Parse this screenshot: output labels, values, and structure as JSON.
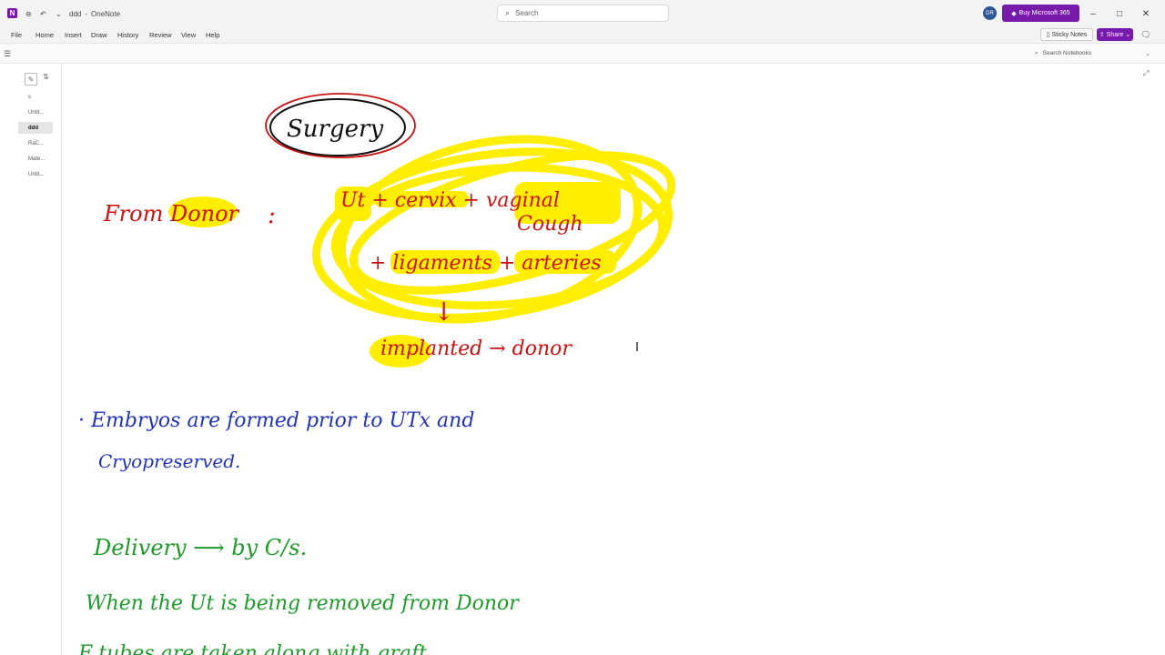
{
  "window": {
    "app_icon_letter": "N",
    "title": "ddd",
    "separator": "-",
    "app_name": "OneNote",
    "search_placeholder": "Search",
    "avatar_initials": "DR",
    "buy_label": "Buy Microsoft 365",
    "controls": {
      "min": "–",
      "max": "□",
      "close": "✕"
    }
  },
  "menu": {
    "items": [
      "File",
      "Home",
      "Insert",
      "Draw",
      "History",
      "Review",
      "View",
      "Help"
    ],
    "sticky_notes": "Sticky Notes",
    "share": "Share",
    "search_notebooks": "Search Notebooks"
  },
  "pages": [
    {
      "label": "s",
      "active": false
    },
    {
      "label": "Untit...",
      "active": false
    },
    {
      "label": "ddd",
      "active": true
    },
    {
      "label": "RaC...",
      "active": false
    },
    {
      "label": "Mate...",
      "active": false
    },
    {
      "label": "Untit...",
      "active": false
    }
  ],
  "notes": {
    "heading": "Surgery",
    "from_donor_label": "From Donor",
    "colon": ":",
    "organs_line1": "Ut + cervix + vaginal",
    "organs_line1b": "Cough",
    "organs_line2": "+ ligaments + arteries",
    "arrow": "↓",
    "implanted": "implanted → donor",
    "embryos_line1": "· Embryos are formed prior to UTx and",
    "embryos_line2": "Cryopreserved.",
    "delivery_line": "Delivery ⟶ by C/s.",
    "when_line": "When the Ut is being removed from Donor",
    "taken_line": "F tubes are taken along with graft",
    "colors": {
      "red": "#cc1111",
      "blue": "#2233bb",
      "green": "#1e9a2a",
      "highlight": "#ffee00",
      "black": "#111111"
    }
  }
}
